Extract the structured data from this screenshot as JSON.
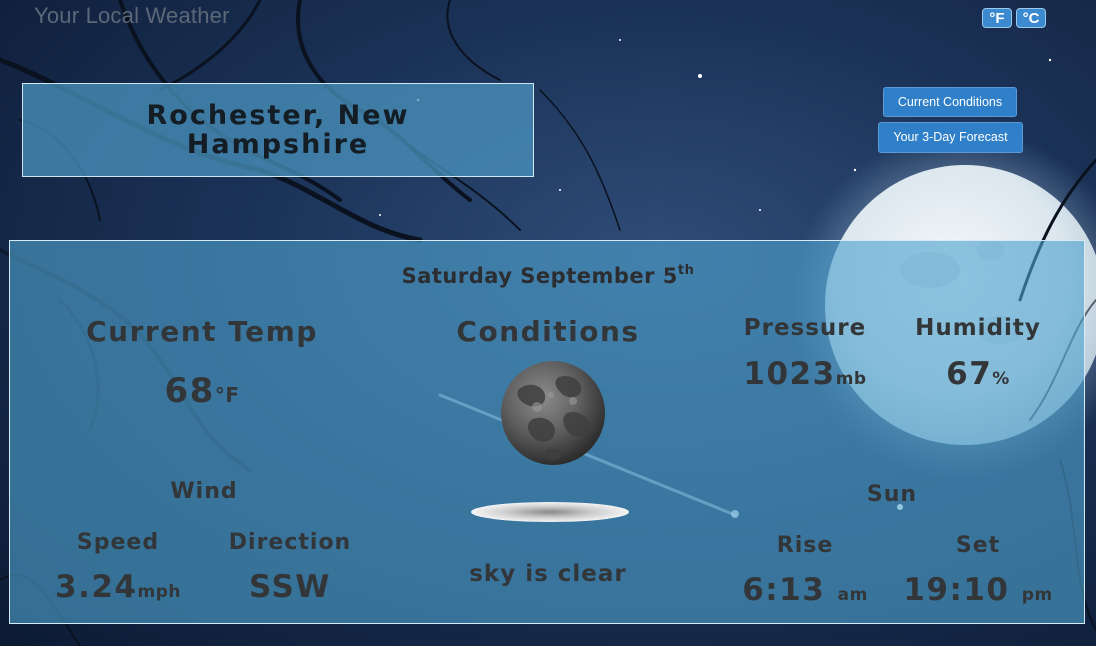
{
  "app": {
    "title": "Your Local Weather"
  },
  "units": {
    "fahrenheit": "°F",
    "celsius": "°C"
  },
  "location": {
    "name": "Rochester, New Hampshire"
  },
  "nav": {
    "current": "Current Conditions",
    "forecast": "Your 3-Day Forecast"
  },
  "date": {
    "text": "Saturday September 5",
    "suffix": "th"
  },
  "temperature": {
    "heading": "Current Temp",
    "value": "68",
    "unit": "°F"
  },
  "conditions": {
    "heading": "Conditions",
    "icon": "night-moon-icon",
    "description": "sky is clear"
  },
  "pressure": {
    "heading": "Pressure",
    "value": "1023",
    "unit": "mb"
  },
  "humidity": {
    "heading": "Humidity",
    "value": "67",
    "unit": "%"
  },
  "wind": {
    "heading": "Wind",
    "speed_label": "Speed",
    "speed_value": "3.24",
    "speed_unit": "mph",
    "direction_label": "Direction",
    "direction_value": "SSW"
  },
  "sun": {
    "heading": "Sun",
    "rise_label": "Rise",
    "rise_value": "6:13",
    "rise_suffix": "am",
    "set_label": "Set",
    "set_value": "19:10",
    "set_suffix": "pm"
  },
  "colors": {
    "accent": "#2f7fc9",
    "panel": "#4ea2cd",
    "text": "#333639"
  }
}
